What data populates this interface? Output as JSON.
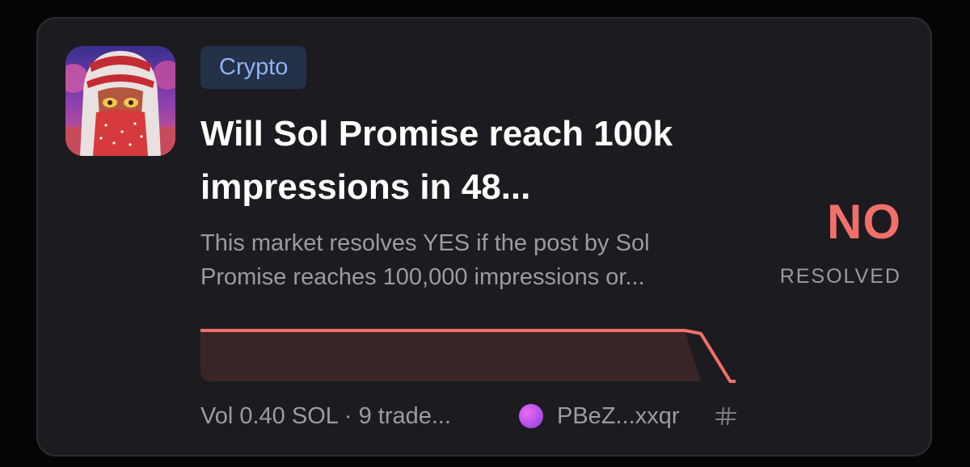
{
  "market": {
    "category": "Crypto",
    "title": "Will Sol Promise reach 100k impressions in 48...",
    "description": "This market resolves YES if the post by Sol Promise reaches 100,000 impressions or...",
    "volume_text": "Vol 0.40 SOL · 9 trade...",
    "creator": "PBeZ...xxqr",
    "outcome": "NO",
    "status": "RESOLVED",
    "avatar_icon": "market-avatar-image",
    "share_icon": "share-icon"
  },
  "price_history": {
    "type": "area",
    "series": [
      {
        "values": [
          1,
          1,
          1,
          0.94,
          0
        ]
      }
    ],
    "ylim": [
      0,
      1
    ]
  },
  "colors": {
    "outcome_no": "#f1706c",
    "tag_bg": "#253049",
    "tag_text": "#8fb3f2",
    "creator_dot": "#c257ee"
  }
}
